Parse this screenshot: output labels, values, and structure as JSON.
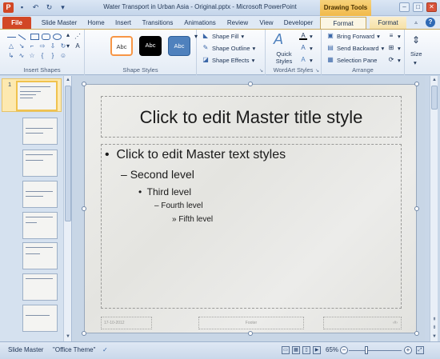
{
  "window": {
    "title": "Water Transport in Urban Asia - Original.pptx - Microsoft PowerPoint",
    "context_tab_group": "Drawing Tools",
    "controls": [
      "minimize-icon",
      "maximize-icon",
      "close-icon"
    ]
  },
  "qat": [
    "powerpoint-icon",
    "save-icon",
    "undo-icon",
    "redo-icon",
    "customize-icon"
  ],
  "tabs": {
    "file": "File",
    "slide_master": "Slide Master",
    "home": "Home",
    "insert": "Insert",
    "transitions": "Transitions",
    "animations": "Animations",
    "review": "Review",
    "view": "View",
    "developer": "Developer",
    "format_active": "Format",
    "format": "Format"
  },
  "ribbon": {
    "insert_shapes": {
      "label": "Insert Shapes"
    },
    "shape_styles": {
      "label": "Shape Styles",
      "presets": [
        "Abc",
        "Abc",
        "Abc"
      ],
      "shape_fill": "Shape Fill",
      "shape_outline": "Shape Outline",
      "shape_effects": "Shape Effects"
    },
    "wordart_styles": {
      "label": "WordArt Styles",
      "quick_styles": "Quick Styles"
    },
    "arrange": {
      "label": "Arrange",
      "bring_forward": "Bring Forward",
      "send_backward": "Send Backward",
      "selection_pane": "Selection Pane"
    },
    "size": {
      "label": "Size"
    }
  },
  "thumbnails": {
    "first_number": "1"
  },
  "slide": {
    "title": "Click to edit Master title style",
    "level1": "Click to edit Master text styles",
    "level2": "Second level",
    "level3": "Third level",
    "level4": "Fourth level",
    "level5": "Fifth level",
    "date": "17-10-2012",
    "footer": "Footer",
    "page_number": "‹#›",
    "bullets": {
      "l1": "•",
      "l2": "–",
      "l3": "•",
      "l4": "–",
      "l5": "»"
    }
  },
  "status": {
    "view": "Slide Master",
    "theme": "\"Office Theme\"",
    "zoom": "65%"
  },
  "colors": {
    "file_tab": "#d24726",
    "context_tab": "#f1b94a",
    "style_black": "#000000",
    "style_blue": "#4f81bd",
    "style_orange_border": "#f79646"
  }
}
